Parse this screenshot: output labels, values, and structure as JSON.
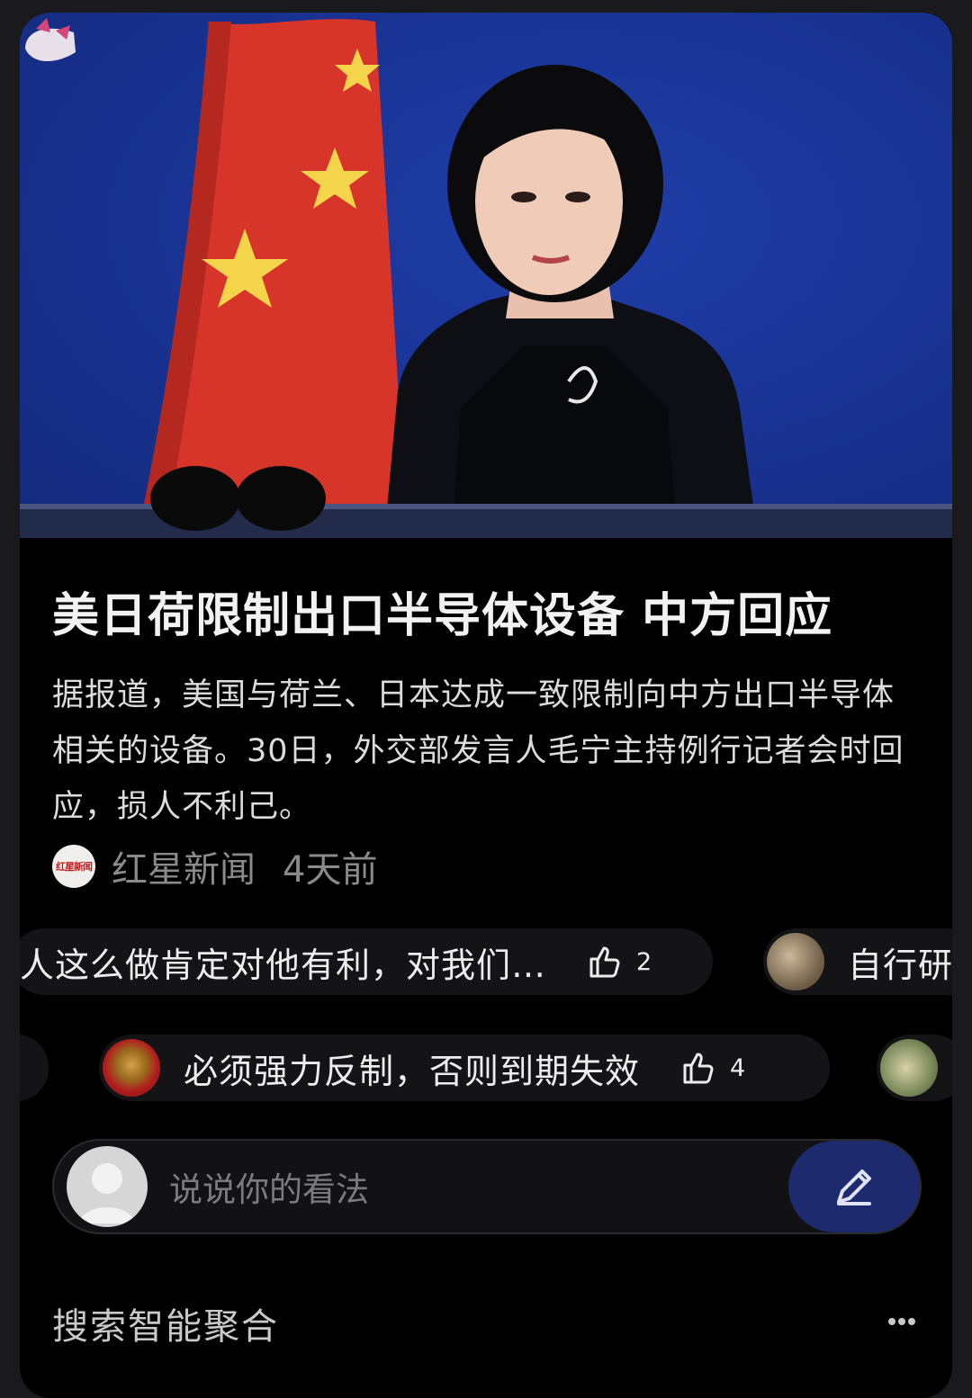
{
  "article": {
    "headline": "美日荷限制出口半导体设备 中方回应",
    "summary": "据报道，美国与荷兰、日本达成一致限制向中方出口半导体相关的设备。30日，外交部发言人毛宁主持例行记者会时回应，损人不利己。",
    "source_name": "红星新闻",
    "source_logo_text": "红星新闻",
    "time_ago": "4天前"
  },
  "comments": [
    {
      "text": "人这么做肯定对他有利，对我们…",
      "likes": "2"
    },
    {
      "text": "自行研"
    },
    {
      "text": "必须强力反制，否则到期失效",
      "likes": "4"
    }
  ],
  "comment_input": {
    "placeholder": "说说你的看法"
  },
  "footer": {
    "title": "搜索智能聚合"
  },
  "colors": {
    "accent_button": "#1e2a6e",
    "flag_red": "#d8352a",
    "backdrop_blue": "#1a3496"
  }
}
